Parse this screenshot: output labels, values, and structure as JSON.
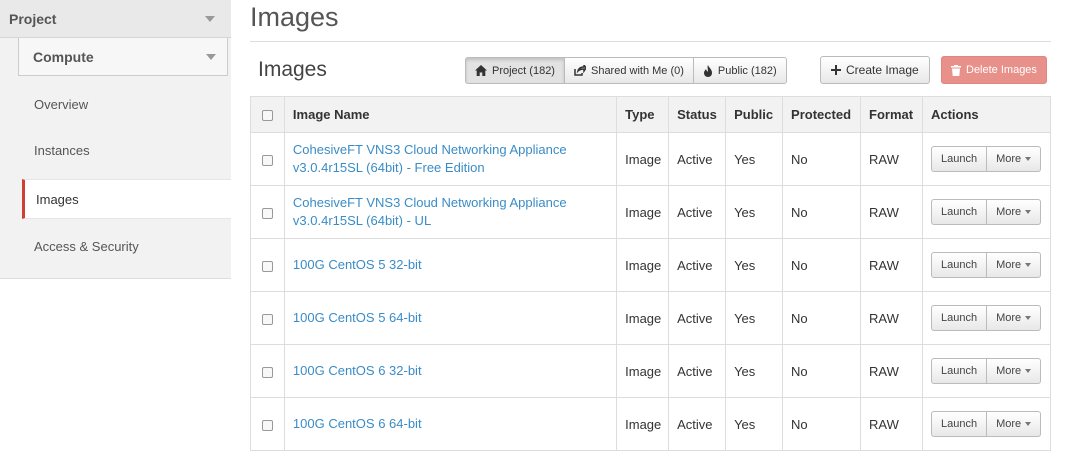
{
  "sidebar": {
    "project_label": "Project",
    "compute_label": "Compute",
    "items": [
      {
        "label": "Overview",
        "active": false
      },
      {
        "label": "Instances",
        "active": false
      },
      {
        "label": "Images",
        "active": true
      },
      {
        "label": "Access & Security",
        "active": false
      }
    ]
  },
  "page": {
    "title": "Images",
    "section_title": "Images"
  },
  "filters": {
    "project": "Project (182)",
    "shared": "Shared with Me (0)",
    "public": "Public (182)"
  },
  "toolbar": {
    "create_label": "Create Image",
    "delete_label": "Delete Images"
  },
  "table": {
    "headers": {
      "name": "Image Name",
      "type": "Type",
      "status": "Status",
      "public": "Public",
      "protected": "Protected",
      "format": "Format",
      "actions": "Actions"
    },
    "launch_label": "Launch",
    "more_label": "More",
    "rows": [
      {
        "name": "CohesiveFT VNS3 Cloud Networking Appliance v3.0.4r15SL (64bit) - Free Edition",
        "type": "Image",
        "status": "Active",
        "public": "Yes",
        "protected": "No",
        "format": "RAW"
      },
      {
        "name": "CohesiveFT VNS3 Cloud Networking Appliance v3.0.4r15SL (64bit) - UL",
        "type": "Image",
        "status": "Active",
        "public": "Yes",
        "protected": "No",
        "format": "RAW"
      },
      {
        "name": "100G CentOS 5 32-bit",
        "type": "Image",
        "status": "Active",
        "public": "Yes",
        "protected": "No",
        "format": "RAW"
      },
      {
        "name": "100G CentOS 5 64-bit",
        "type": "Image",
        "status": "Active",
        "public": "Yes",
        "protected": "No",
        "format": "RAW"
      },
      {
        "name": "100G CentOS 6 32-bit",
        "type": "Image",
        "status": "Active",
        "public": "Yes",
        "protected": "No",
        "format": "RAW"
      },
      {
        "name": "100G CentOS 6 64-bit",
        "type": "Image",
        "status": "Active",
        "public": "Yes",
        "protected": "No",
        "format": "RAW"
      }
    ]
  },
  "colors": {
    "link": "#3a8cc6",
    "active_accent": "#d13f34",
    "delete_button": "#e8908a"
  }
}
